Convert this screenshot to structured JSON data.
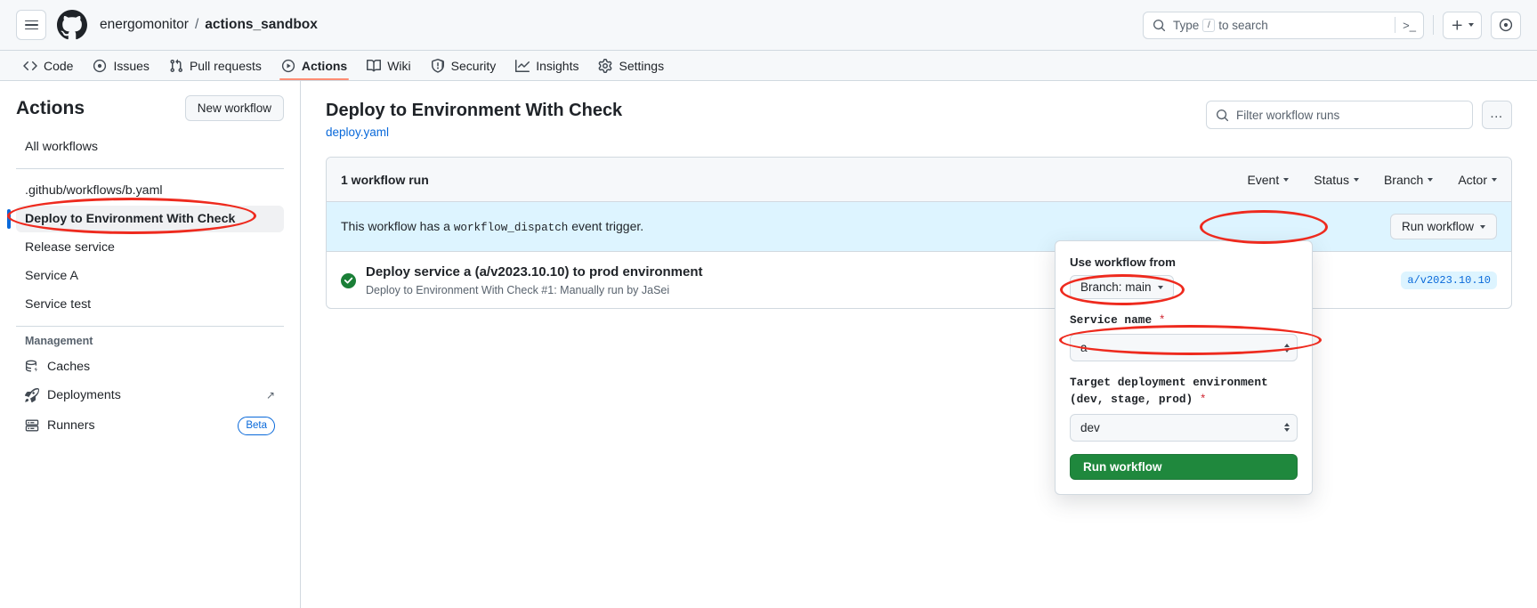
{
  "header": {
    "menu_icon": "hamburger-icon",
    "logo_icon": "github-logo-icon",
    "owner": "energomonitor",
    "separator": "/",
    "repo": "actions_sandbox",
    "search": {
      "icon": "search-icon",
      "placeholder_prefix": "Type",
      "key_hint": "/",
      "placeholder_suffix": "to search",
      "terminal_icon": "terminal-icon"
    },
    "create_button": {
      "label": "+",
      "icon": "plus-icon",
      "caret": "chevron-down-icon"
    },
    "issues_button": {
      "icon": "issue-opened-icon"
    }
  },
  "repo_nav": {
    "items": [
      {
        "label": "Code",
        "icon": "code-icon",
        "active": false
      },
      {
        "label": "Issues",
        "icon": "issue-opened-icon",
        "active": false
      },
      {
        "label": "Pull requests",
        "icon": "git-pull-request-icon",
        "active": false
      },
      {
        "label": "Actions",
        "icon": "play-icon",
        "active": true
      },
      {
        "label": "Wiki",
        "icon": "book-icon",
        "active": false
      },
      {
        "label": "Security",
        "icon": "shield-icon",
        "active": false
      },
      {
        "label": "Insights",
        "icon": "graph-icon",
        "active": false
      },
      {
        "label": "Settings",
        "icon": "gear-icon",
        "active": false
      }
    ]
  },
  "sidebar": {
    "title": "Actions",
    "new_workflow_label": "New workflow",
    "all_workflows": "All workflows",
    "workflows": [
      {
        "label": ".github/workflows/b.yaml",
        "selected": false
      },
      {
        "label": "Deploy to Environment With Check",
        "selected": true
      },
      {
        "label": "Release service",
        "selected": false
      },
      {
        "label": "Service A",
        "selected": false
      },
      {
        "label": "Service test",
        "selected": false
      }
    ],
    "management_title": "Management",
    "management": [
      {
        "label": "Caches",
        "icon": "cache-icon",
        "external": false,
        "badge": ""
      },
      {
        "label": "Deployments",
        "icon": "rocket-icon",
        "external": true,
        "badge": ""
      },
      {
        "label": "Runners",
        "icon": "server-icon",
        "external": false,
        "badge": "Beta"
      }
    ],
    "external_icon": "arrow-up-right-icon"
  },
  "main": {
    "title": "Deploy to Environment With Check",
    "file_link": "deploy.yaml",
    "filter": {
      "icon": "search-icon",
      "placeholder": "Filter workflow runs"
    },
    "more_button": "…",
    "runs": {
      "count_label": "1 workflow run",
      "filters": [
        {
          "label": "Event"
        },
        {
          "label": "Status"
        },
        {
          "label": "Branch"
        },
        {
          "label": "Actor"
        }
      ],
      "dispatch_banner": {
        "text_before": "This workflow has a",
        "code": "workflow_dispatch",
        "text_after": "event trigger.",
        "run_button": "Run workflow"
      },
      "items": [
        {
          "status_icon": "check-circle-fill-icon",
          "status_color": "#1a7f37",
          "title": "Deploy service a (a/v2023.10.10) to prod environment",
          "meta": "Deploy to Environment With Check #1: Manually run by JaSei",
          "tag": "a/v2023.10.10"
        }
      ]
    }
  },
  "workflow_panel": {
    "use_workflow_from_label": "Use workflow from",
    "branch_button": "Branch: main",
    "service_name_label": "Service name",
    "service_name_required": "*",
    "service_name_value": "a",
    "target_env_label": "Target deployment environment (dev, stage, prod)",
    "target_env_required": "*",
    "target_env_value": "dev",
    "submit_label": "Run workflow"
  },
  "annotations": {
    "color": "#ee2a1e",
    "marks": [
      {
        "name": "sidebar-workflow-highlight"
      },
      {
        "name": "run-workflow-button-highlight"
      },
      {
        "name": "branch-selector-highlight"
      },
      {
        "name": "service-name-select-highlight"
      }
    ]
  }
}
